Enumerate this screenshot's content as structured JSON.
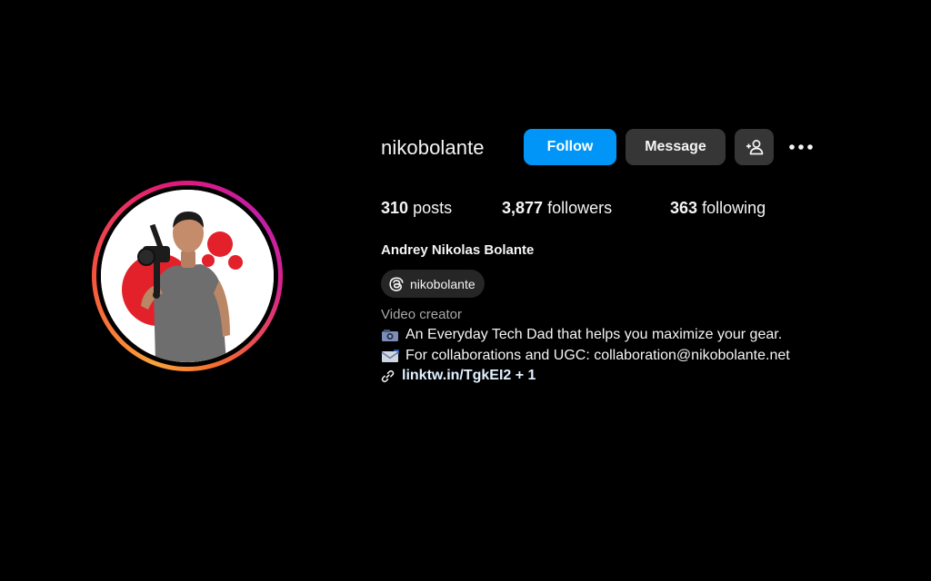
{
  "profile": {
    "username": "nikobolante",
    "full_name": "Andrey Nikolas Bolante",
    "threads_handle": "nikobolante",
    "category": "Video creator",
    "avatar_ring_colors": [
      "#f9a23a",
      "#f5523c",
      "#e01a7a",
      "#c21ea8"
    ]
  },
  "actions": {
    "follow_label": "Follow",
    "message_label": "Message",
    "suggest_icon": "add-person-icon",
    "more_icon": "more-options-icon"
  },
  "stats": {
    "posts_count": "310",
    "posts_label": "posts",
    "followers_count": "3,877",
    "followers_label": "followers",
    "following_count": "363",
    "following_label": "following"
  },
  "bio": {
    "line1_icon": "video-camera-emoji",
    "line1_text": "An Everyday Tech Dad that helps you maximize your gear.",
    "line2_icon": "envelope-emoji",
    "line2_text": "For collaborations and UGC: collaboration@nikobolante.net",
    "link_icon": "link-icon",
    "link_text": "linktw.in/TgkEI2 + 1"
  },
  "colors": {
    "background": "#000000",
    "primary_button": "#0095f6",
    "secondary_button": "#363636",
    "muted_text": "#a8a8a8"
  }
}
